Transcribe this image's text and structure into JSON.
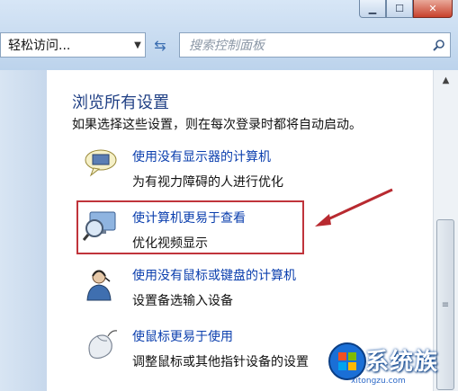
{
  "window": {
    "buttons": {
      "minimize_icon": "minimize-icon",
      "maximize_icon": "maximize-icon",
      "close_icon": "close-icon"
    }
  },
  "toolbar": {
    "breadcrumb": "轻松访问...",
    "search_placeholder": "搜索控制面板"
  },
  "main": {
    "heading": "浏览所有设置",
    "description": "如果选择这些设置，则在每次登录时都将自动启动。",
    "items": [
      {
        "icon": "monitor-speech-icon",
        "link": "使用没有显示器的计算机",
        "sub": "为有视力障碍的人进行优化"
      },
      {
        "icon": "monitor-magnifier-icon",
        "link": "使计算机更易于查看",
        "sub": "优化视频显示"
      },
      {
        "icon": "user-headset-icon",
        "link": "使用没有鼠标或键盘的计算机",
        "sub": "设置备选输入设备"
      },
      {
        "icon": "mouse-icon",
        "link": "使鼠标更易于使用",
        "sub": "调整鼠标或其他指针设备的设置"
      }
    ]
  },
  "watermark": {
    "text": "系统族",
    "url": "xitongzu.com"
  },
  "colors": {
    "link": "#0b3fae",
    "heading": "#1f3f84",
    "highlight": "#c0343b"
  }
}
